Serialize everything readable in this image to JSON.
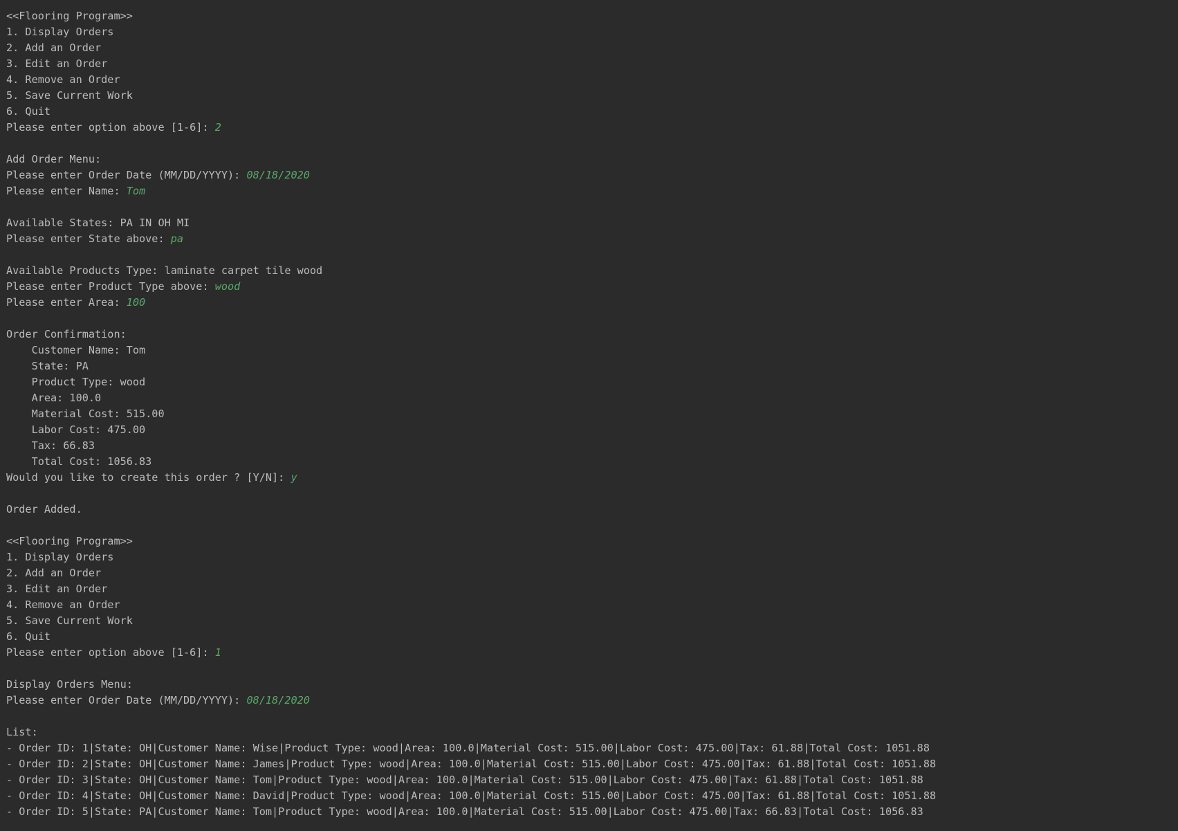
{
  "colors": {
    "background": "#2b2b2b",
    "output_text": "#bbbbbb",
    "user_input": "#59a869"
  },
  "lines": [
    {
      "text": "<<Flooring Program>>"
    },
    {
      "text": "1. Display Orders"
    },
    {
      "text": "2. Add an Order"
    },
    {
      "text": "3. Edit an Order"
    },
    {
      "text": "4. Remove an Order"
    },
    {
      "text": "5. Save Current Work"
    },
    {
      "text": "6. Quit"
    },
    {
      "text": "Please enter option above [1-6]: ",
      "input": "2"
    },
    {
      "text": ""
    },
    {
      "text": "Add Order Menu:"
    },
    {
      "text": "Please enter Order Date (MM/DD/YYYY): ",
      "input": "08/18/2020"
    },
    {
      "text": "Please enter Name: ",
      "input": "Tom"
    },
    {
      "text": ""
    },
    {
      "text": "Available States: PA IN OH MI"
    },
    {
      "text": "Please enter State above: ",
      "input": "pa"
    },
    {
      "text": ""
    },
    {
      "text": "Available Products Type: laminate carpet tile wood"
    },
    {
      "text": "Please enter Product Type above: ",
      "input": "wood"
    },
    {
      "text": "Please enter Area: ",
      "input": "100"
    },
    {
      "text": ""
    },
    {
      "text": "Order Confirmation:"
    },
    {
      "text": "    Customer Name: Tom"
    },
    {
      "text": "    State: PA"
    },
    {
      "text": "    Product Type: wood"
    },
    {
      "text": "    Area: 100.0"
    },
    {
      "text": "    Material Cost: 515.00"
    },
    {
      "text": "    Labor Cost: 475.00"
    },
    {
      "text": "    Tax: 66.83"
    },
    {
      "text": "    Total Cost: 1056.83"
    },
    {
      "text": "Would you like to create this order ? [Y/N]: ",
      "input": "y"
    },
    {
      "text": ""
    },
    {
      "text": "Order Added."
    },
    {
      "text": ""
    },
    {
      "text": "<<Flooring Program>>"
    },
    {
      "text": "1. Display Orders"
    },
    {
      "text": "2. Add an Order"
    },
    {
      "text": "3. Edit an Order"
    },
    {
      "text": "4. Remove an Order"
    },
    {
      "text": "5. Save Current Work"
    },
    {
      "text": "6. Quit"
    },
    {
      "text": "Please enter option above [1-6]: ",
      "input": "1"
    },
    {
      "text": ""
    },
    {
      "text": "Display Orders Menu:"
    },
    {
      "text": "Please enter Order Date (MM/DD/YYYY): ",
      "input": "08/18/2020"
    },
    {
      "text": ""
    },
    {
      "text": "List:"
    },
    {
      "text": "- Order ID: 1|State: OH|Customer Name: Wise|Product Type: wood|Area: 100.0|Material Cost: 515.00|Labor Cost: 475.00|Tax: 61.88|Total Cost: 1051.88"
    },
    {
      "text": "- Order ID: 2|State: OH|Customer Name: James|Product Type: wood|Area: 100.0|Material Cost: 515.00|Labor Cost: 475.00|Tax: 61.88|Total Cost: 1051.88"
    },
    {
      "text": "- Order ID: 3|State: OH|Customer Name: Tom|Product Type: wood|Area: 100.0|Material Cost: 515.00|Labor Cost: 475.00|Tax: 61.88|Total Cost: 1051.88"
    },
    {
      "text": "- Order ID: 4|State: OH|Customer Name: David|Product Type: wood|Area: 100.0|Material Cost: 515.00|Labor Cost: 475.00|Tax: 61.88|Total Cost: 1051.88"
    },
    {
      "text": "- Order ID: 5|State: PA|Customer Name: Tom|Product Type: wood|Area: 100.0|Material Cost: 515.00|Labor Cost: 475.00|Tax: 66.83|Total Cost: 1056.83"
    }
  ]
}
